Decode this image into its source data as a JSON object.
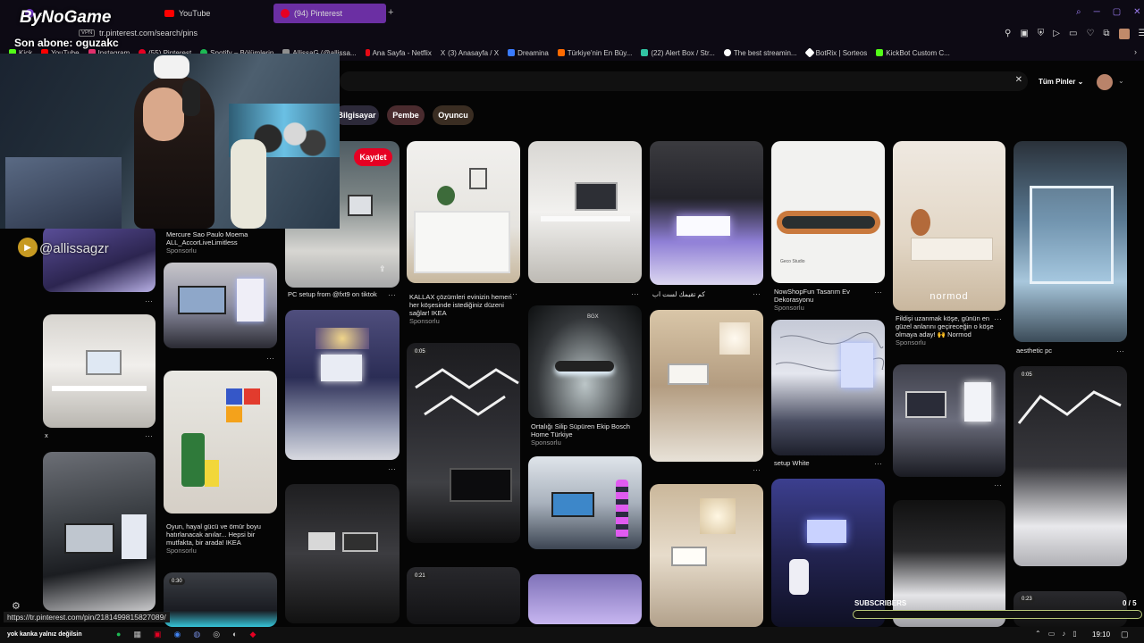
{
  "stream_overlay": {
    "channel_logo": "ByNoGame",
    "sub_text": "Son abone: oguzakc",
    "handle": "@allissagzr",
    "subscribers_label": "SUBSCRIBERS",
    "subscribers_count": "0 / 5",
    "subscribers_progress": 0
  },
  "tabs": [
    {
      "label": "...",
      "color": "#9146ff"
    },
    {
      "label": "YouTube",
      "color": "#ff0000"
    },
    {
      "label": "(94) Pinterest",
      "color": "#e60023"
    }
  ],
  "url": {
    "vpn": "VPN",
    "address": "tr.pinterest.com/search/pins"
  },
  "bookmarks": [
    {
      "label": "Kick",
      "color": "#53fc18"
    },
    {
      "label": "YouTube",
      "color": "#ff0000"
    },
    {
      "label": "Instagram",
      "color": "#e1306c"
    },
    {
      "label": "(55) Pinterest",
      "color": "#e60023"
    },
    {
      "label": "Spotify – Bölümlerin",
      "color": "#1db954"
    },
    {
      "label": "AllissaG (@allissa...",
      "color": "#8f8f8f"
    },
    {
      "label": "Ana Sayfa - Netflix",
      "color": "#e50914"
    },
    {
      "label": "(3) Anasayfa / X",
      "color": "#ffffff"
    },
    {
      "label": "Dreamina",
      "color": "#3a7bff"
    },
    {
      "label": "Türkiye'nin En Büy...",
      "color": "#ff6a00"
    },
    {
      "label": "(22) Alert Box / Str...",
      "color": "#31c3a2"
    },
    {
      "label": "The best streamin...",
      "color": "#ffffff"
    },
    {
      "label": "BotRix | Sorteos",
      "color": "#ffffff"
    },
    {
      "label": "KickBot Custom C...",
      "color": "#53fc18"
    }
  ],
  "search": {
    "filter_label": "Tüm Pinler",
    "chips": [
      "Bilgisayar",
      "Pembe",
      "Oyuncu"
    ]
  },
  "save_button": "Kaydet",
  "captions": {
    "c1a": "Mercure Sao Paulo Moema ALL_AccorLiveLimitless",
    "c1b": "Sponsorlu",
    "c2": "PC setup from @fxt9 on tiktok",
    "c3a": "KALLAX çözümleri evinizin hemen her köşesinde istediğiniz düzeni sağlar! IKEA",
    "c3b": "Sponsorlu",
    "c4": "كم تقيمك لست اب",
    "c5a": "NowShopFun Tasarım Ev Dekorasyonu",
    "c5b": "Sponsorlu",
    "c6a": "Fildişi uzanmak köşe, günün en güzel anlarını geçireceğin o köşe olmaya aday! 🙌 Normod",
    "c6b": "Sponsorlu",
    "c7": "aesthetic pc",
    "c8": "x",
    "c9a": "Oyun, hayal gücü ve ömür boyu hatırlanacak anılar... Hepsi bir mutfakta, bir arada! IKEA",
    "c9b": "Sponsorlu",
    "c10a": "Ortalığı Silip Süpüren Ekip Bosch Home Türkiye",
    "c10b": "Sponsorlu",
    "c11": "setup White",
    "normod": "normod",
    "geco": "Geco Studio",
    "bgx": "BGX"
  },
  "video_badges": [
    "0:05",
    "0:05",
    "0:30",
    "0:21",
    "0:23"
  ],
  "status_url": "https://tr.pinterest.com/pin/2181499815827089/",
  "taskbar": {
    "ticker": "yok kanka yalnız değilsin",
    "clock": "19:10"
  }
}
